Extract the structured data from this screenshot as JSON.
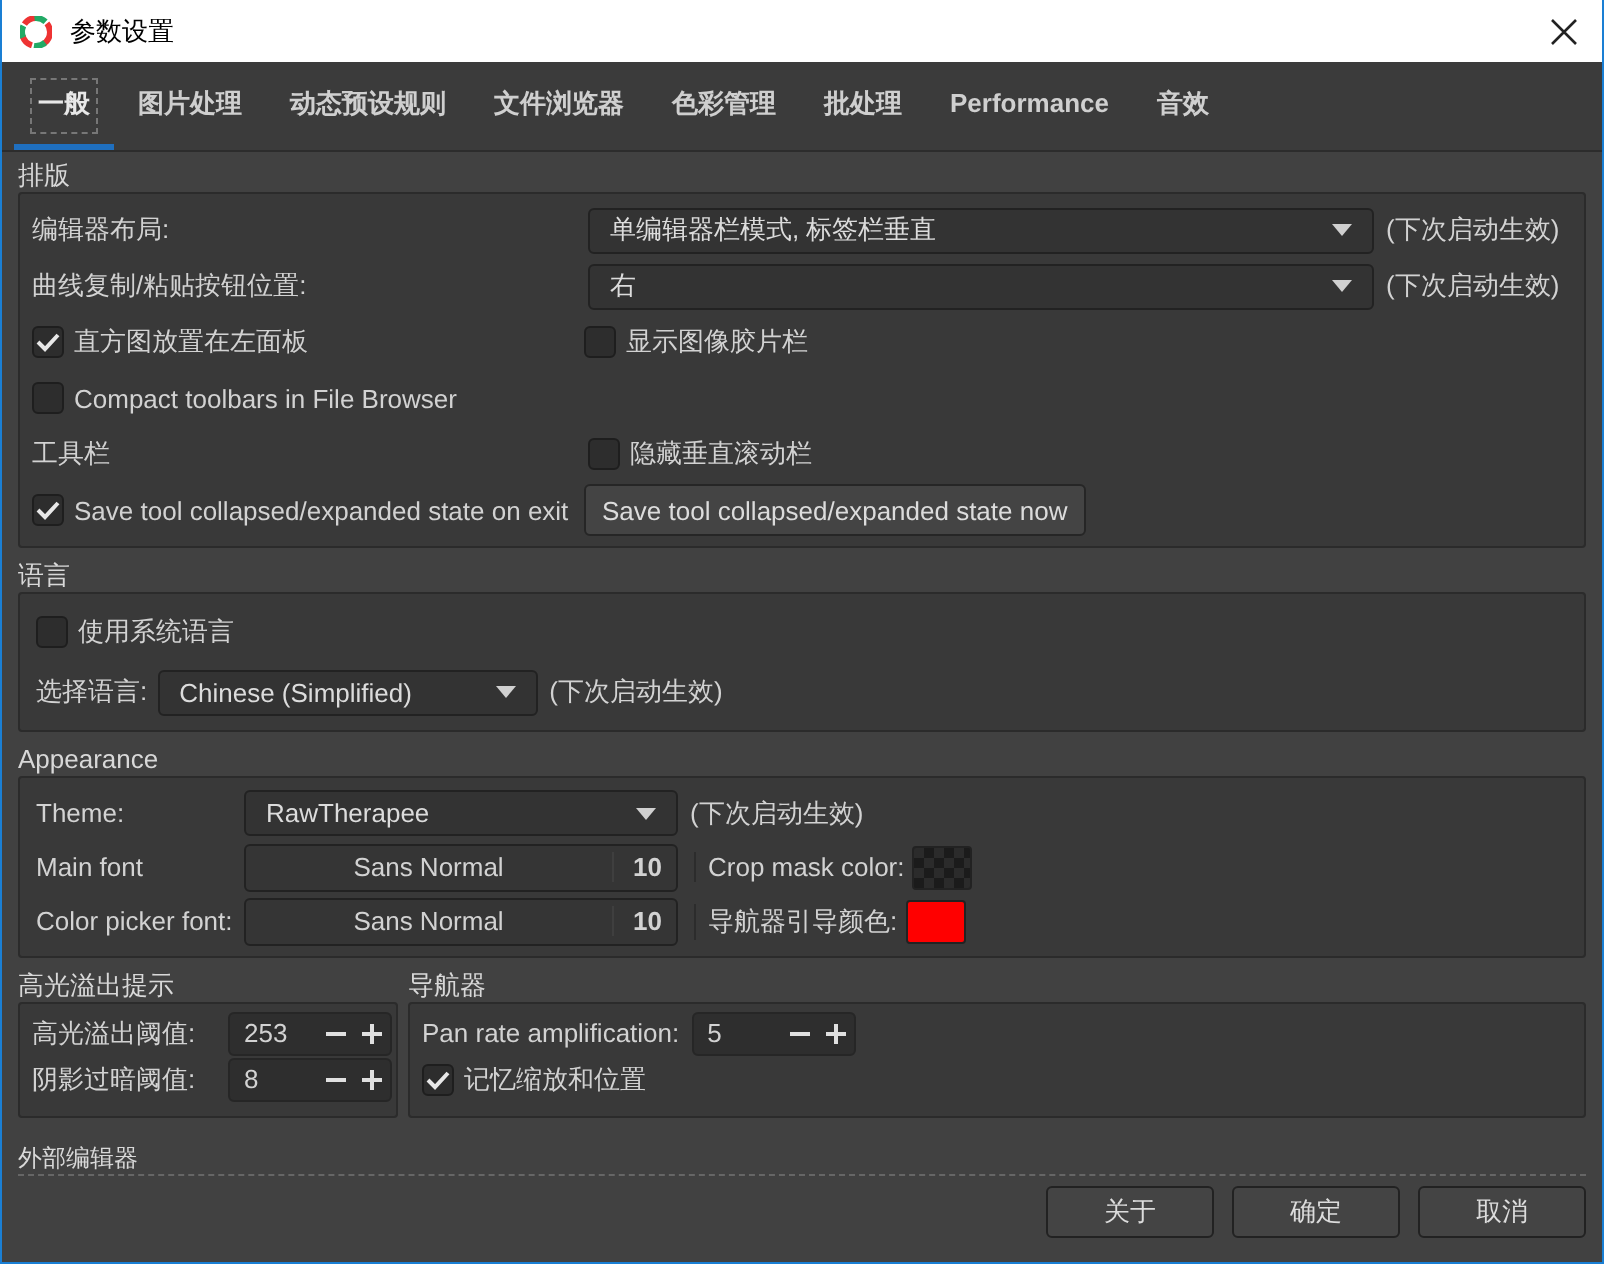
{
  "window": {
    "title": "参数设置"
  },
  "tabs": [
    {
      "label": "一般",
      "selected": true
    },
    {
      "label": "图片处理",
      "selected": false
    },
    {
      "label": "动态预设规则",
      "selected": false
    },
    {
      "label": "文件浏览器",
      "selected": false
    },
    {
      "label": "色彩管理",
      "selected": false
    },
    {
      "label": "批处理",
      "selected": false
    },
    {
      "label": "Performance",
      "selected": false
    },
    {
      "label": "音效",
      "selected": false
    }
  ],
  "sections": [
    {
      "kind": "layout",
      "title": "排版",
      "rows": [
        [
          {
            "kind": "label",
            "text": "编辑器布局:"
          },
          {
            "kind": "dropdown",
            "value": "单编辑器栏模式, 标签栏垂直"
          },
          {
            "kind": "note",
            "text": "(下次启动生效)"
          }
        ],
        [
          {
            "kind": "label",
            "text": "曲线复制/粘贴按钮位置:"
          },
          {
            "kind": "dropdown",
            "value": "右"
          },
          {
            "kind": "note",
            "text": "(下次启动生效)"
          }
        ],
        [
          {
            "kind": "checkbox",
            "label": "直方图放置在左面板",
            "checked": true
          },
          {
            "kind": "checkbox",
            "label": "显示图像胶片栏",
            "checked": false
          }
        ],
        [
          {
            "kind": "checkbox",
            "label": "Compact toolbars in File Browser",
            "checked": false
          }
        ],
        [
          {
            "kind": "label",
            "text": "工具栏"
          },
          {
            "kind": "checkbox",
            "label": "隐藏垂直滚动栏",
            "checked": false
          }
        ],
        [
          {
            "kind": "checkbox",
            "label": "Save tool collapsed/expanded state on exit",
            "checked": true
          },
          {
            "kind": "button",
            "label": "Save tool collapsed/expanded state now"
          }
        ]
      ]
    },
    {
      "kind": "language",
      "title": "语言",
      "rows": [
        [
          {
            "kind": "checkbox",
            "label": "使用系统语言",
            "checked": false
          }
        ],
        [
          {
            "kind": "label",
            "text": "选择语言:"
          },
          {
            "kind": "dropdown",
            "value": "Chinese (Simplified)"
          },
          {
            "kind": "note",
            "text": "(下次启动生效)"
          }
        ]
      ]
    },
    {
      "kind": "appearance",
      "title": "Appearance",
      "rows": [
        [
          {
            "kind": "label",
            "text": "Theme:"
          },
          {
            "kind": "dropdown",
            "value": "RawTherapee"
          },
          {
            "kind": "note",
            "text": "(下次启动生效)"
          }
        ],
        [
          {
            "kind": "label",
            "text": "Main font"
          },
          {
            "kind": "font",
            "name": "Sans Normal",
            "size": "10"
          },
          {
            "kind": "label",
            "text": "Crop mask color:"
          },
          {
            "kind": "checker_swatch"
          }
        ],
        [
          {
            "kind": "label",
            "text": "Color picker font:"
          },
          {
            "kind": "font",
            "name": "Sans Normal",
            "size": "10"
          },
          {
            "kind": "label",
            "text": "导航器引导颜色:"
          },
          {
            "kind": "swatch",
            "color": "#ff0000"
          }
        ]
      ]
    },
    {
      "kind": "highlight",
      "title": "高光溢出提示",
      "rows": [
        [
          {
            "kind": "label",
            "text": "高光溢出阈值:"
          },
          {
            "kind": "spin",
            "value": "253"
          }
        ],
        [
          {
            "kind": "label",
            "text": "阴影过暗阈值:"
          },
          {
            "kind": "spin",
            "value": "8"
          }
        ]
      ]
    },
    {
      "kind": "navigator",
      "title": "导航器",
      "rows": [
        [
          {
            "kind": "label",
            "text": "Pan rate amplification:"
          },
          {
            "kind": "spin",
            "value": "5"
          }
        ],
        [
          {
            "kind": "checkbox",
            "label": "记忆缩放和位置",
            "checked": true
          }
        ]
      ]
    },
    {
      "kind": "cut",
      "title": "外部编辑器"
    }
  ],
  "buttons": [
    "关于",
    "确定",
    "取消"
  ]
}
